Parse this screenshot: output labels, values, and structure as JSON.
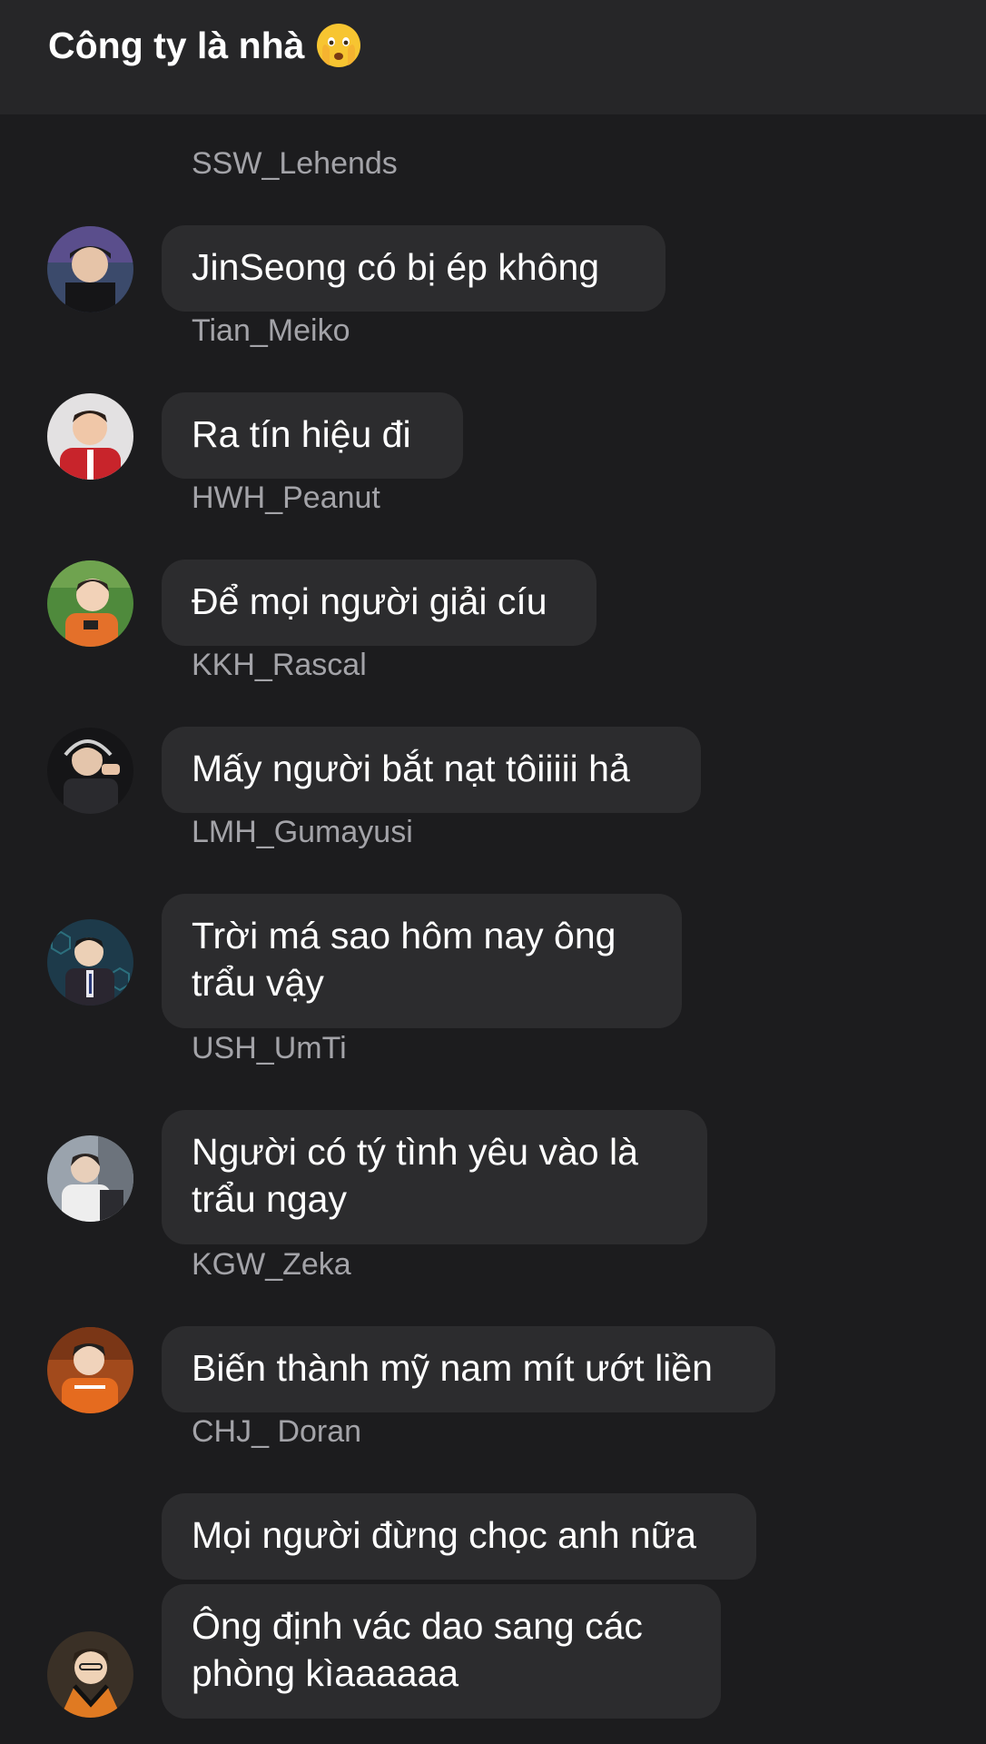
{
  "header": {
    "title": "Công ty là nhà",
    "emoji_icon": "face-with-open-eyes-and-hand-over-mouth-icon"
  },
  "messages": [
    {
      "sender": "SSW_Lehends",
      "text": "JinSeong có bị ép không",
      "avatar_color": "#3b4a6b"
    },
    {
      "sender": "Tian_Meiko",
      "text": "Ra tín hiệu đi",
      "avatar_color": "#c8242b"
    },
    {
      "sender": "HWH_Peanut",
      "text": "Để mọi người giải cíu",
      "avatar_color": "#4f8a3c"
    },
    {
      "sender": "KKH_Rascal",
      "text": "Mấy người bắt nạt tôiiiii hả",
      "avatar_color": "#222226"
    },
    {
      "sender": "LMH_Gumayusi",
      "text": "Trời má sao hôm nay ông trẩu vậy",
      "avatar_color": "#1d3a4a"
    },
    {
      "sender": "USH_UmTi",
      "text": "Người có tý tình yêu vào là trẩu ngay",
      "avatar_color": "#8a8f95"
    },
    {
      "sender": "KGW_Zeka",
      "text": "Biến thành mỹ nam mít ướt liền",
      "avatar_color": "#e56b1f"
    },
    {
      "sender": "CHJ_ Doran",
      "texts": [
        "Mọi người đừng chọc anh nữa",
        "Ông định vác dao sang các phòng kìaaaaaa"
      ],
      "avatar_color": "#e07a22"
    }
  ]
}
